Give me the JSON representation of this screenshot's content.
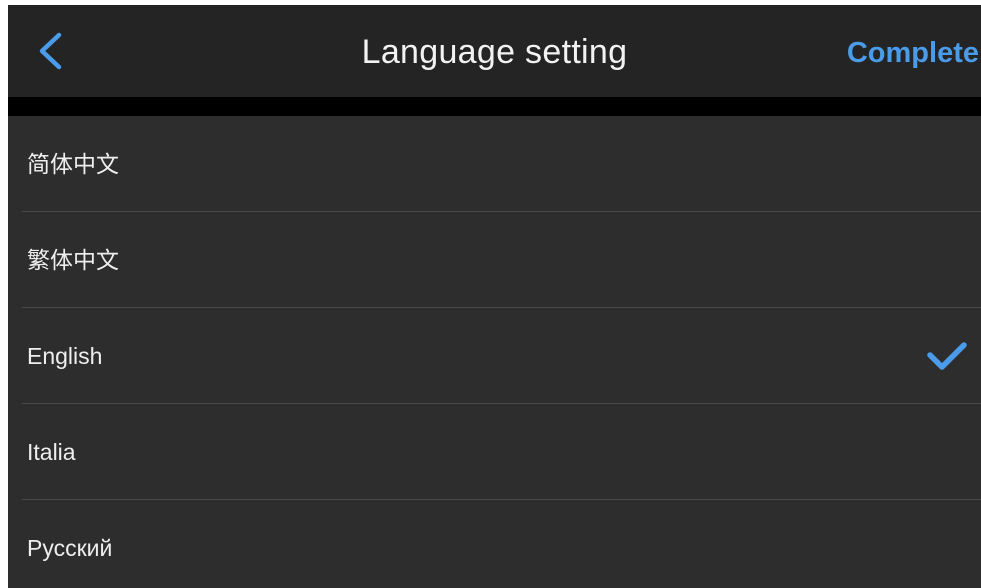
{
  "header": {
    "title": "Language setting",
    "back_icon": "chevron-left-icon",
    "complete_label": "Complete"
  },
  "languages": [
    {
      "label": "简体中文",
      "selected": false
    },
    {
      "label": "繁体中文",
      "selected": false
    },
    {
      "label": "English",
      "selected": true
    },
    {
      "label": "Italia",
      "selected": false
    },
    {
      "label": "Русский",
      "selected": false
    }
  ],
  "selected_icon": "checkmark-icon",
  "colors": {
    "accent": "#4a9bea",
    "background": "#2d2d2d",
    "header_background": "#242424",
    "divider_band": "#000000",
    "text": "#eeeeee"
  }
}
